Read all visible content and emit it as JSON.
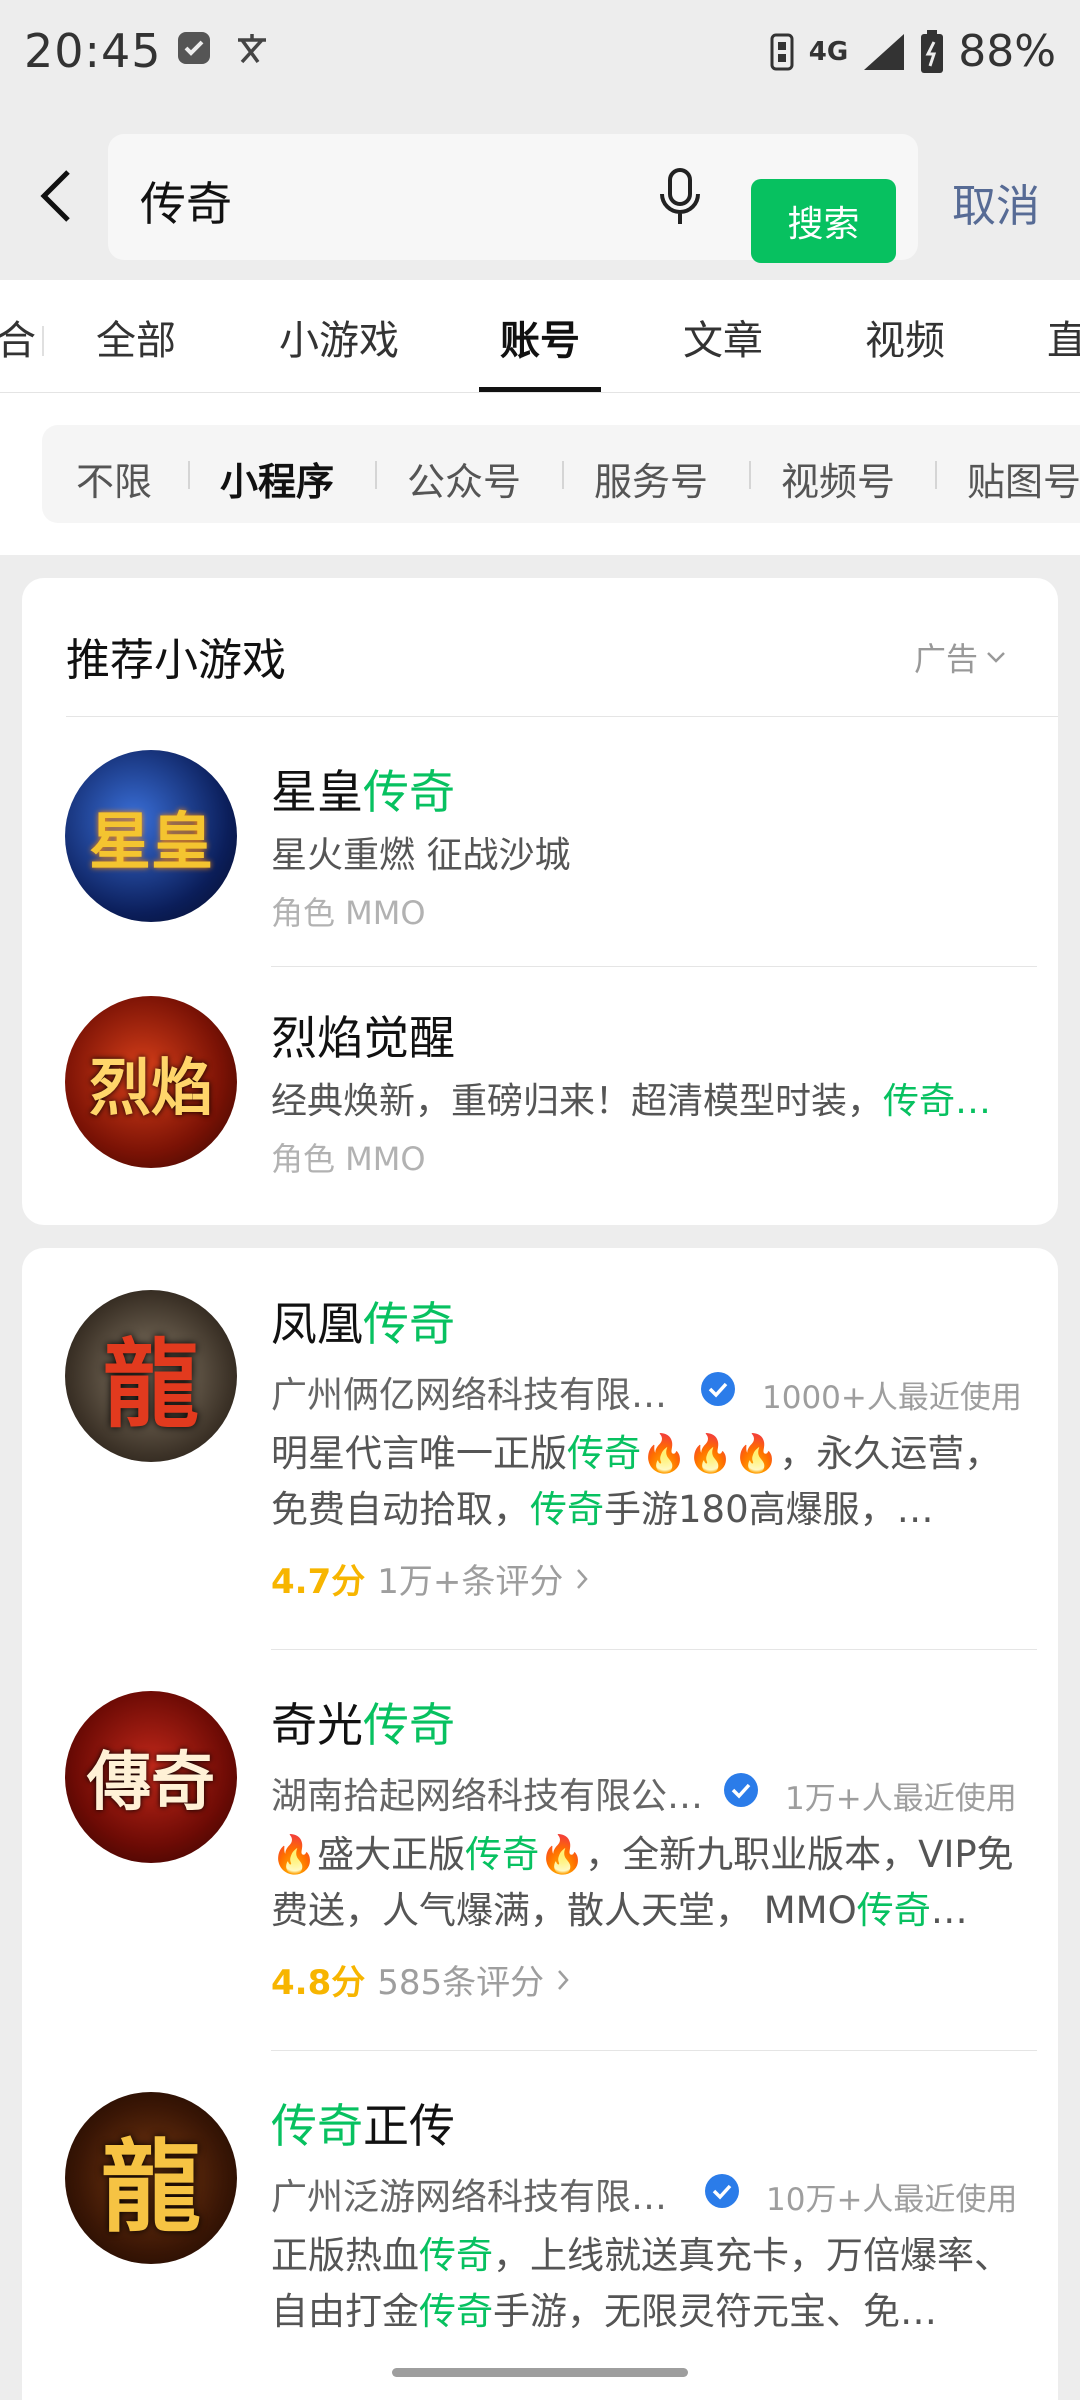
{
  "status_bar": {
    "time": "20:45",
    "network": "4G",
    "battery": "88%"
  },
  "search": {
    "query": "传奇",
    "button_label": "搜索",
    "cancel_label": "取消"
  },
  "tabs": [
    "综合",
    "全部",
    "小游戏",
    "账号",
    "文章",
    "视频",
    "直播"
  ],
  "active_tab": "账号",
  "filters": [
    "不限",
    "小程序",
    "公众号",
    "服务号",
    "视频号",
    "贴图号"
  ],
  "active_filter": "小程序",
  "recommend": {
    "title": "推荐小游戏",
    "ad_label": "广告",
    "items": [
      {
        "name_prefix": "星皇",
        "name_hl": "传奇",
        "desc": "星火重燃 征战沙城",
        "tag": "角色 MMO",
        "avatar_text": "星皇"
      },
      {
        "name": "烈焰觉醒",
        "desc_prefix": "经典焕新，重磅归来！超清模型时装，",
        "desc_hl": "传奇…",
        "tag": "角色 MMO",
        "avatar_text": "烈焰"
      }
    ]
  },
  "results": [
    {
      "name_prefix": "凤凰",
      "name_hl": "传奇",
      "org": "广州俩亿网络科技有限…",
      "users": "1000+人最近使用",
      "desc_parts": [
        "明星代言唯一正版",
        "传奇",
        "🔥🔥🔥，永久运营，免费自动拾取，",
        "传奇",
        "手游180高爆服，…"
      ],
      "score": "4.7分",
      "reviews": "1万+条评分",
      "avatar_text": "龍"
    },
    {
      "name_prefix": "奇光",
      "name_hl": "传奇",
      "org": "湖南拾起网络科技有限公…",
      "users": "1万+人最近使用",
      "desc_parts": [
        "🔥盛大正版",
        "传奇",
        "🔥，全新九职业版本，VIP免费送，人气爆满，散人天堂， MMO",
        "传奇",
        "…"
      ],
      "score": "4.8分",
      "reviews": "585条评分",
      "avatar_text": "傳奇"
    },
    {
      "name_hl": "传奇",
      "name_suffix": "正传",
      "org": "广州泛游网络科技有限…",
      "users": "10万+人最近使用",
      "desc_parts": [
        "正版热血",
        "传奇",
        "，上线就送真充卡，万倍爆率、自由打金",
        "传奇",
        "手游，无限灵符元宝、免…"
      ],
      "avatar_text": "龍"
    }
  ],
  "colors": {
    "accent": "#07C160",
    "link": "#576B95",
    "star": "#F7B500",
    "background": "#EDEDED"
  }
}
